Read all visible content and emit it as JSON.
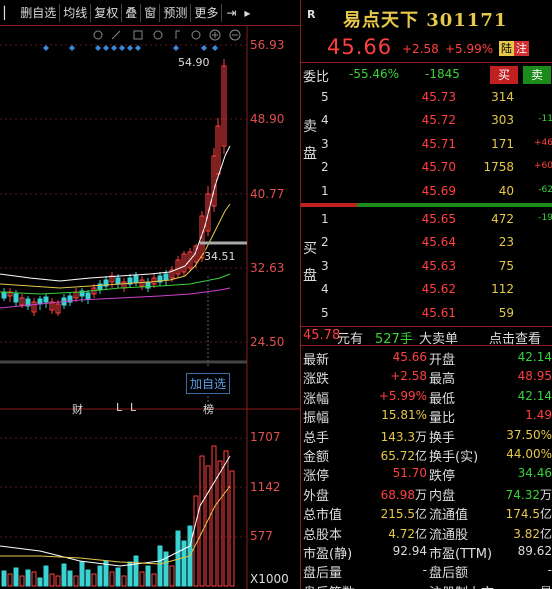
{
  "toolbar": {
    "buttons": [
      "删自选",
      "均线",
      "复权",
      "叠",
      "窗",
      "预测",
      "更多"
    ]
  },
  "chart": {
    "price_ticks": [
      "56.93",
      "48.90",
      "40.77",
      "32.63",
      "24.50"
    ],
    "volume_ticks": [
      "1707",
      "1142",
      "577"
    ],
    "volume_unit": "X1000",
    "high_marker": "54.90",
    "low_marker": "34.51",
    "add_favorite": "加自选",
    "x_labels": [
      "财",
      "L",
      "L",
      "榜"
    ]
  },
  "header": {
    "badge": "R",
    "name_code": "易点天下 301171",
    "price": "45.66",
    "change": "+2.58",
    "change_pct": "+5.99%",
    "tag_lu": "陆",
    "tag_zhu": "注"
  },
  "weibi": {
    "label": "委比",
    "pct": "-55.46%",
    "diff": "-1845",
    "buy_btn": "买",
    "sell_btn": "卖"
  },
  "sell_side_label": [
    "卖",
    "盘"
  ],
  "buy_side_label": [
    "买",
    "盘"
  ],
  "asks": [
    {
      "level": "5",
      "price": "45.73",
      "volume": "314",
      "change": ""
    },
    {
      "level": "4",
      "price": "45.72",
      "volume": "303",
      "change": "-11"
    },
    {
      "level": "3",
      "price": "45.71",
      "volume": "171",
      "change": "+46"
    },
    {
      "level": "2",
      "price": "45.70",
      "volume": "1758",
      "change": "+60"
    },
    {
      "level": "1",
      "price": "45.69",
      "volume": "40",
      "change": "-62"
    }
  ],
  "bids": [
    {
      "level": "1",
      "price": "45.65",
      "volume": "472",
      "change": "-19"
    },
    {
      "level": "2",
      "price": "45.64",
      "volume": "23",
      "change": ""
    },
    {
      "level": "3",
      "price": "45.63",
      "volume": "75",
      "change": ""
    },
    {
      "level": "4",
      "price": "45.62",
      "volume": "112",
      "change": ""
    },
    {
      "level": "5",
      "price": "45.61",
      "volume": "59",
      "change": ""
    }
  ],
  "trade": {
    "price": "45.78",
    "unit": "元有",
    "volume": "527手",
    "label": "大卖单",
    "link": "点击查看"
  },
  "stats": [
    {
      "l": "最新",
      "lv": "45.66",
      "lc": "#ff4040",
      "lu": "",
      "r": "开盘",
      "rv": "42.14",
      "rc": "#3ad23a",
      "ru": ""
    },
    {
      "l": "涨跌",
      "lv": "+2.58",
      "lc": "#ff4040",
      "lu": "",
      "r": "最高",
      "rv": "48.95",
      "rc": "#ff4040",
      "ru": ""
    },
    {
      "l": "涨幅",
      "lv": "+5.99%",
      "lc": "#ff4040",
      "lu": "",
      "r": "最低",
      "rv": "42.14",
      "rc": "#3ad23a",
      "ru": ""
    },
    {
      "l": "振幅",
      "lv": "15.81%",
      "lc": "#e6c84a",
      "lu": "",
      "r": "量比",
      "rv": "1.49",
      "rc": "#ff4040",
      "ru": ""
    },
    {
      "l": "总手",
      "lv": "143.3",
      "lc": "#e6c84a",
      "lu": "万",
      "r": "换手",
      "rv": "37.50%",
      "rc": "#e6c84a",
      "ru": ""
    },
    {
      "l": "金额",
      "lv": "65.72",
      "lc": "#e6c84a",
      "lu": "亿",
      "r": "换手(实)",
      "rv": "44.00%",
      "rc": "#e6c84a",
      "ru": ""
    },
    {
      "l": "涨停",
      "lv": "51.70",
      "lc": "#ff4040",
      "lu": "",
      "r": "跌停",
      "rv": "34.46",
      "rc": "#3ad23a",
      "ru": ""
    },
    {
      "l": "外盘",
      "lv": "68.98",
      "lc": "#ff4040",
      "lu": "万",
      "r": "内盘",
      "rv": "74.32",
      "rc": "#3ad23a",
      "ru": "万"
    },
    {
      "l": "总市值",
      "lv": "215.5",
      "lc": "#e6c84a",
      "lu": "亿",
      "r": "流通值",
      "rv": "174.5",
      "rc": "#e6c84a",
      "ru": "亿"
    },
    {
      "l": "总股本",
      "lv": "4.72",
      "lc": "#e6c84a",
      "lu": "亿",
      "r": "流通股",
      "rv": "3.82",
      "rc": "#e6c84a",
      "ru": "亿"
    },
    {
      "l": "市盈(静)",
      "lv": "92.94",
      "lc": "#dcdcdc",
      "lu": "",
      "r": "市盈(TTM)",
      "rv": "89.62",
      "rc": "#dcdcdc",
      "ru": ""
    },
    {
      "l": "盘后量",
      "lv": "-",
      "lc": "#dcdcdc",
      "lu": "",
      "r": "盘后额",
      "rv": "-",
      "rc": "#dcdcdc",
      "ru": ""
    },
    {
      "l": "盘后笔数",
      "lv": "-",
      "lc": "#dcdcdc",
      "lu": "",
      "r": "注册制上市",
      "rv": "是",
      "rc": "#dcdcdc",
      "ru": ""
    }
  ]
}
